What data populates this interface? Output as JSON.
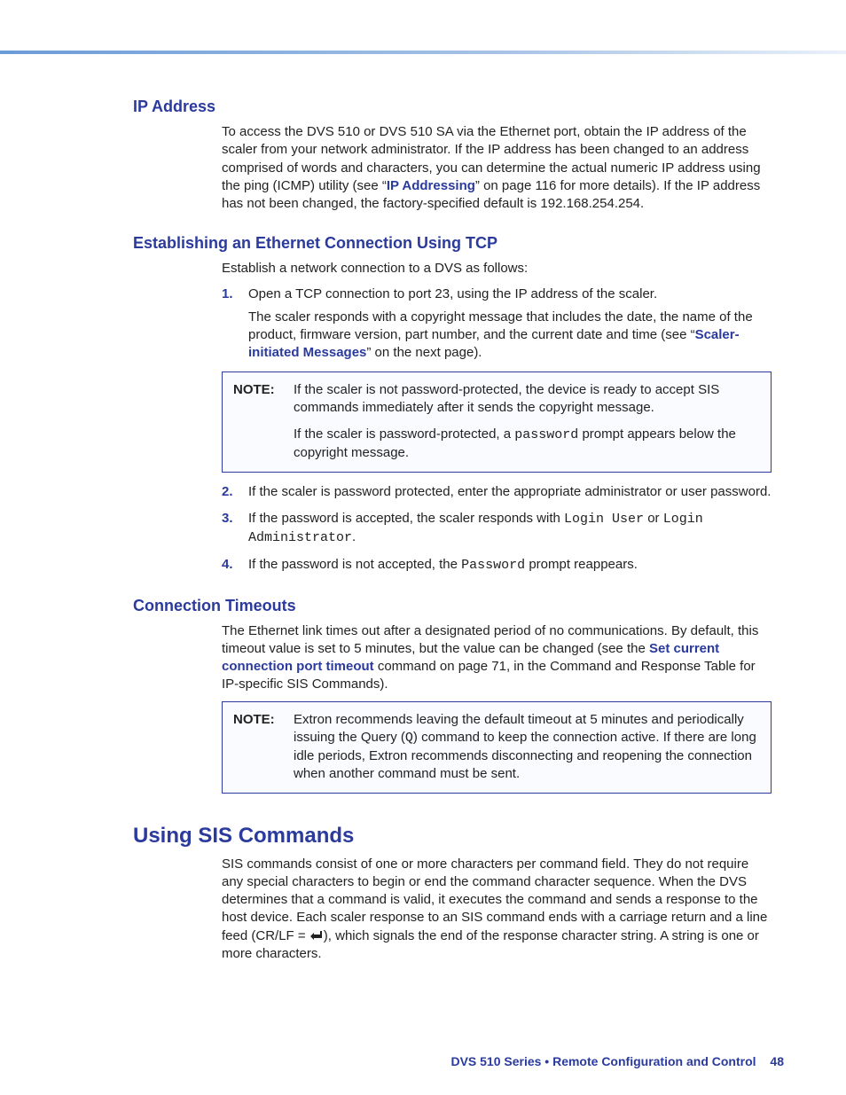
{
  "sections": {
    "ip_address": {
      "heading": "IP Address",
      "para_pre": "To access the DVS 510 or DVS 510 SA via the Ethernet port, obtain the IP address of the scaler from your network administrator. If the IP address has been changed to an address comprised of words and characters, you can determine the actual numeric IP address using the ping (ICMP) utility (see “",
      "link": "IP Addressing",
      "para_post": "” on page 116 for more details). If the IP address has not been changed, the factory-specified default is 192.168.254.254."
    },
    "establishing": {
      "heading": "Establishing an Ethernet Connection Using TCP",
      "intro": "Establish a network connection to a DVS as follows:",
      "step1_a": "Open a TCP connection to port 23, using the IP address of the scaler.",
      "step1_b_pre": "The scaler responds with a copyright message that includes the date, the name of the product, firmware version, part number, and the current date and time (see “",
      "step1_link": "Scaler-initiated Messages",
      "step1_b_post": "” on the next page).",
      "note1_label": "NOTE:",
      "note1_a": "If the scaler is not password-protected, the device is ready to accept SIS commands immediately after it sends the copyright message.",
      "note1_b_pre": "If the scaler is password-protected, a ",
      "note1_b_mono": "password",
      "note1_b_post": " prompt appears below the copyright message.",
      "step2": "If the scaler is password protected, enter the appropriate administrator or user password.",
      "step3_pre": "If the password is accepted, the scaler responds with ",
      "step3_m1": "Login User",
      "step3_mid": " or ",
      "step3_m2": "Login Administrator",
      "step3_post": ".",
      "step4_pre": "If the password is not accepted, the ",
      "step4_mono": "Password",
      "step4_post": " prompt reappears.",
      "n1": "1.",
      "n2": "2.",
      "n3": "3.",
      "n4": "4."
    },
    "timeouts": {
      "heading": "Connection Timeouts",
      "para_pre": "The Ethernet link times out after a designated period of no communications. By default, this timeout value is set to 5 minutes, but the value can be changed (see the ",
      "link": "Set current connection port timeout",
      "para_post": " command on page 71, in the Command and Response Table for IP-specific SIS Commands).",
      "note_label": "NOTE:",
      "note_pre": "Extron recommends leaving the default timeout at 5 minutes and periodically issuing the Query (",
      "note_mono": "Q",
      "note_post": ") command to keep the connection active. If there are long idle periods, Extron recommends disconnecting and reopening the connection when another command must be sent."
    },
    "using_sis": {
      "heading": "Using SIS Commands",
      "para_pre": "SIS commands consist of one or more characters per command field. They do not require any special characters to begin or end the command character sequence. When the DVS determines that a command is valid, it executes the command and sends a response to the host device. Each scaler response to an SIS command ends with a carriage return and a line feed (CR/LF = ",
      "para_post": "), which signals the end of the response character string. A string is one or more characters."
    }
  },
  "footer": {
    "title": "DVS 510 Series • Remote Configuration and Control",
    "page": "48"
  }
}
